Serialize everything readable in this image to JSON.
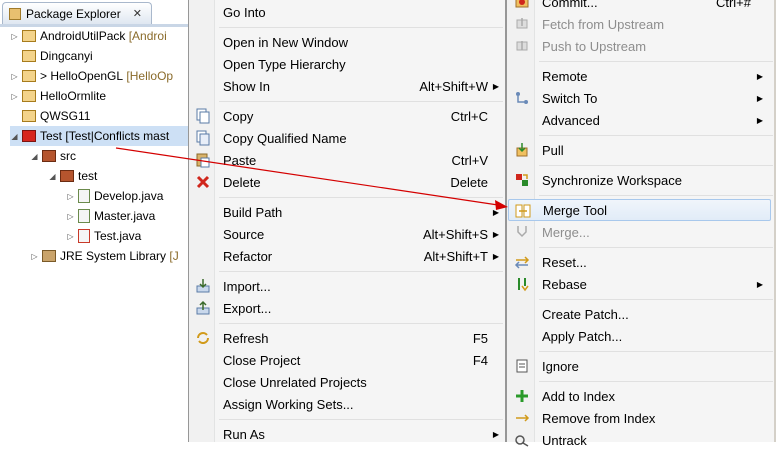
{
  "explorer": {
    "tab_label": "Package Explorer",
    "tab_close": "✕",
    "items": [
      {
        "label": "AndroidUtilPack",
        "decoration": "[Androi",
        "expanded": false
      },
      {
        "label": "Dingcanyi",
        "decoration": ""
      },
      {
        "label": "> HelloOpenGL",
        "decoration": "[HelloOp",
        "expanded": false
      },
      {
        "label": "HelloOrmlite",
        "decoration": "",
        "expanded": false
      },
      {
        "label": "QWSG11",
        "decoration": ""
      },
      {
        "label": "Test",
        "decoration": "[Test|Conflicts mast",
        "expanded": true
      },
      {
        "label": "src",
        "decoration": "",
        "expanded": true
      },
      {
        "label": "test",
        "decoration": "",
        "expanded": true
      },
      {
        "label": "Develop.java",
        "decoration": ""
      },
      {
        "label": "Master.java",
        "decoration": ""
      },
      {
        "label": "Test.java",
        "decoration": ""
      },
      {
        "label": "JRE System Library",
        "decoration": "[J",
        "expanded": false
      }
    ]
  },
  "context_menu": {
    "items": [
      {
        "label": "Go Into",
        "shortcut": "",
        "submenu": false,
        "icon": ""
      },
      {
        "label": "Open in New Window",
        "shortcut": "",
        "submenu": false,
        "icon": ""
      },
      {
        "label": "Open Type Hierarchy",
        "shortcut": "",
        "submenu": false,
        "icon": ""
      },
      {
        "label": "Show In",
        "shortcut": "Alt+Shift+W",
        "submenu": true,
        "icon": ""
      },
      {
        "label": "Copy",
        "shortcut": "Ctrl+C",
        "submenu": false,
        "icon": "copy-icon"
      },
      {
        "label": "Copy Qualified Name",
        "shortcut": "",
        "submenu": false,
        "icon": "copy-qualified-icon"
      },
      {
        "label": "Paste",
        "shortcut": "Ctrl+V",
        "submenu": false,
        "icon": "paste-icon"
      },
      {
        "label": "Delete",
        "shortcut": "Delete",
        "submenu": false,
        "icon": "delete-icon"
      },
      {
        "label": "Build Path",
        "shortcut": "",
        "submenu": true,
        "icon": ""
      },
      {
        "label": "Source",
        "shortcut": "Alt+Shift+S",
        "submenu": true,
        "icon": ""
      },
      {
        "label": "Refactor",
        "shortcut": "Alt+Shift+T",
        "submenu": true,
        "icon": ""
      },
      {
        "label": "Import...",
        "shortcut": "",
        "submenu": false,
        "icon": "import-icon"
      },
      {
        "label": "Export...",
        "shortcut": "",
        "submenu": false,
        "icon": "export-icon"
      },
      {
        "label": "Refresh",
        "shortcut": "F5",
        "submenu": false,
        "icon": "refresh-icon"
      },
      {
        "label": "Close Project",
        "shortcut": "F4",
        "submenu": false,
        "icon": ""
      },
      {
        "label": "Close Unrelated Projects",
        "shortcut": "",
        "submenu": false,
        "icon": ""
      },
      {
        "label": "Assign Working Sets...",
        "shortcut": "",
        "submenu": false,
        "icon": ""
      },
      {
        "label": "Run As",
        "shortcut": "",
        "submenu": true,
        "icon": ""
      }
    ]
  },
  "team_menu": {
    "items": [
      {
        "label": "Commit...",
        "shortcut": "Ctrl+#",
        "submenu": false,
        "disabled": false,
        "icon": "commit-icon"
      },
      {
        "label": "Fetch from Upstream",
        "shortcut": "",
        "submenu": false,
        "disabled": true,
        "icon": "fetch-icon"
      },
      {
        "label": "Push to Upstream",
        "shortcut": "",
        "submenu": false,
        "disabled": true,
        "icon": "push-icon"
      },
      {
        "label": "Remote",
        "shortcut": "",
        "submenu": true,
        "disabled": false,
        "icon": ""
      },
      {
        "label": "Switch To",
        "shortcut": "",
        "submenu": true,
        "disabled": false,
        "icon": "switch-branch-icon"
      },
      {
        "label": "Advanced",
        "shortcut": "",
        "submenu": true,
        "disabled": false,
        "icon": ""
      },
      {
        "label": "Pull",
        "shortcut": "",
        "submenu": false,
        "disabled": false,
        "icon": "pull-icon"
      },
      {
        "label": "Synchronize Workspace",
        "shortcut": "",
        "submenu": false,
        "disabled": false,
        "icon": "synchronize-icon"
      },
      {
        "label": "Merge Tool",
        "shortcut": "",
        "submenu": false,
        "disabled": false,
        "icon": "merge-tool-icon",
        "highlighted": true
      },
      {
        "label": "Merge...",
        "shortcut": "",
        "submenu": false,
        "disabled": true,
        "icon": "merge-icon"
      },
      {
        "label": "Reset...",
        "shortcut": "",
        "submenu": false,
        "disabled": false,
        "icon": "reset-icon"
      },
      {
        "label": "Rebase",
        "shortcut": "",
        "submenu": true,
        "disabled": false,
        "icon": "rebase-icon"
      },
      {
        "label": "Create Patch...",
        "shortcut": "",
        "submenu": false,
        "disabled": false,
        "icon": ""
      },
      {
        "label": "Apply Patch...",
        "shortcut": "",
        "submenu": false,
        "disabled": false,
        "icon": ""
      },
      {
        "label": "Ignore",
        "shortcut": "",
        "submenu": false,
        "disabled": false,
        "icon": "ignore-icon"
      },
      {
        "label": "Add to Index",
        "shortcut": "",
        "submenu": false,
        "disabled": false,
        "icon": "add-to-index-icon"
      },
      {
        "label": "Remove from Index",
        "shortcut": "",
        "submenu": false,
        "disabled": false,
        "icon": "remove-from-index-icon"
      },
      {
        "label": "Untrack",
        "shortcut": "",
        "submenu": false,
        "disabled": false,
        "icon": "untrack-icon"
      }
    ]
  },
  "colors": {
    "annotation_arrow": "#d40000",
    "hover_border": "#a8c8ec",
    "menu_bg": "#f5f5f5",
    "disabled_text": "#8d8d8d"
  }
}
